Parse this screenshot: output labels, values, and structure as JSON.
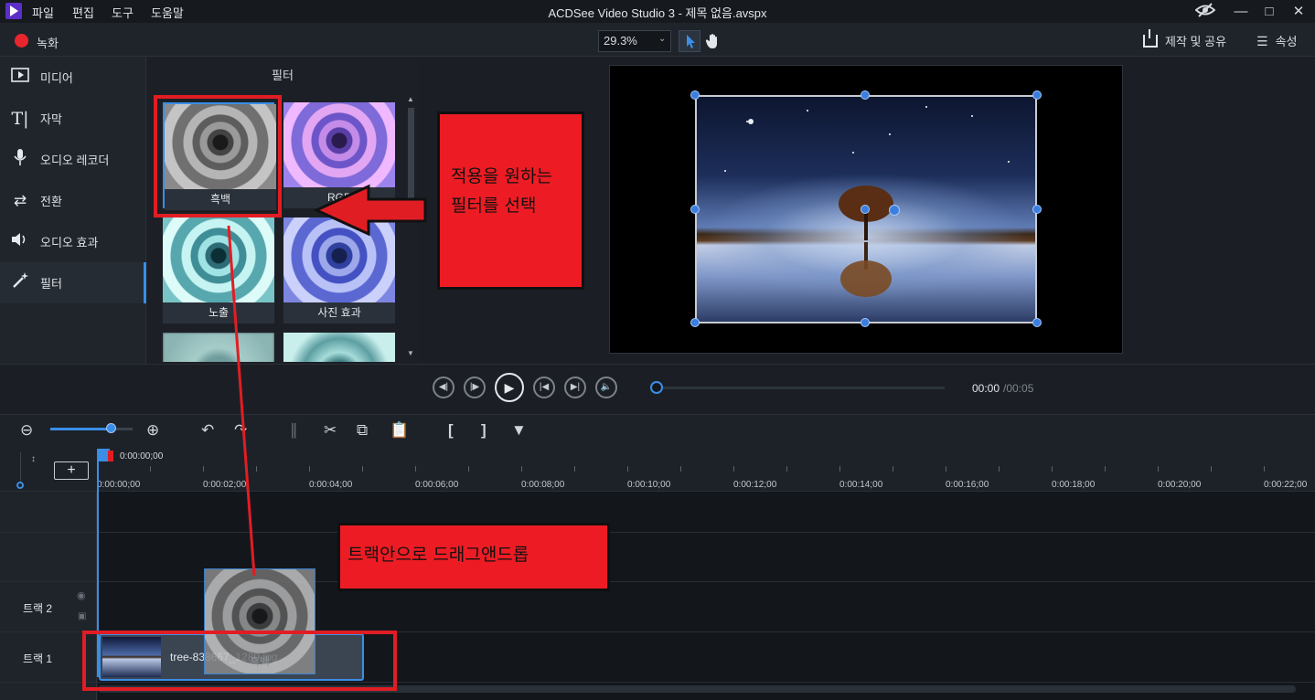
{
  "app": {
    "title": "ACDSee Video Studio 3 - 제목 없음.avspx",
    "menu": [
      "파일",
      "편집",
      "도구",
      "도움말"
    ]
  },
  "toolbar": {
    "record_label": "녹화",
    "zoom": "29.3%",
    "share_label": "제작 및 공유",
    "properties_label": "속성"
  },
  "sidebar": {
    "items": [
      {
        "label": "미디어",
        "icon": "play-box-icon"
      },
      {
        "label": "자막",
        "icon": "text-icon"
      },
      {
        "label": "오디오 레코더",
        "icon": "microphone-icon"
      },
      {
        "label": "전환",
        "icon": "transition-arrows-icon"
      },
      {
        "label": "오디오 효과",
        "icon": "speaker-icon"
      },
      {
        "label": "필터",
        "icon": "magic-wand-icon"
      }
    ],
    "active_index": 5
  },
  "filter_panel": {
    "title": "필터",
    "items": [
      {
        "label": "흑백"
      },
      {
        "label": "RGB"
      },
      {
        "label": "노출"
      },
      {
        "label": "사진 효과"
      },
      {
        "label": ""
      },
      {
        "label": ""
      }
    ]
  },
  "player": {
    "current_time": "00:00",
    "total_time": "/00:05",
    "progress": 0
  },
  "timeline": {
    "playhead_time": "0:00:00;00",
    "ruler": [
      "0:00:00;00",
      "0:00:02;00",
      "0:00:04;00",
      "0:00:06;00",
      "0:00:08;00",
      "0:00:10;00",
      "0:00:12;00",
      "0:00:14;00",
      "0:00:16;00",
      "0:00:18;00",
      "0:00:20;00",
      "0:00:22;00"
    ],
    "tracks": [
      {
        "label": "트랙 2"
      },
      {
        "label": "트랙 1"
      }
    ],
    "clip_name": "tree-838667_1280.jpg",
    "drag_label": "흑백"
  },
  "annotations": {
    "select_note_line1": "적용을 원하는",
    "select_note_line2": "필터를 선택",
    "drag_note": "트랙안으로 드래그앤드롭"
  },
  "colors": {
    "accent": "#3a8ee6",
    "annotation_red": "#ed1c24"
  }
}
